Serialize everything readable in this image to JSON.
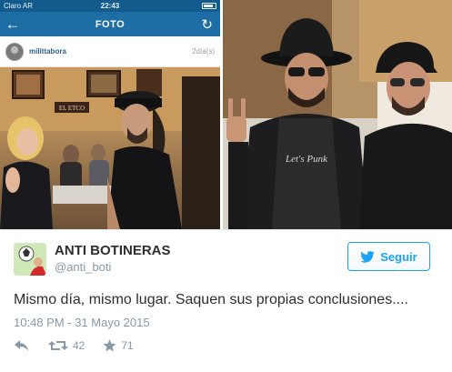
{
  "instagram": {
    "status": {
      "carrier": "Claro AR",
      "time": "22:43"
    },
    "header_title": "FOTO",
    "username": "milittabora",
    "time_ago": "2día(s)",
    "sign_text": "EL ETCO"
  },
  "photo2": {
    "shirt_text": "Let's Punk"
  },
  "tweet": {
    "display_name": "ANTI BOTINERAS",
    "handle": "@anti_boti",
    "follow_label": "Seguir",
    "text": "Mismo día, mismo lugar. Saquen sus propias conclusiones....",
    "datetime": "10:48 PM - 31 Mayo 2015",
    "retweets": "42",
    "favorites": "71"
  },
  "colors": {
    "instagram_bar": "#1c6ea4",
    "twitter_blue": "#1da1f2",
    "text_secondary": "#8899a6"
  }
}
